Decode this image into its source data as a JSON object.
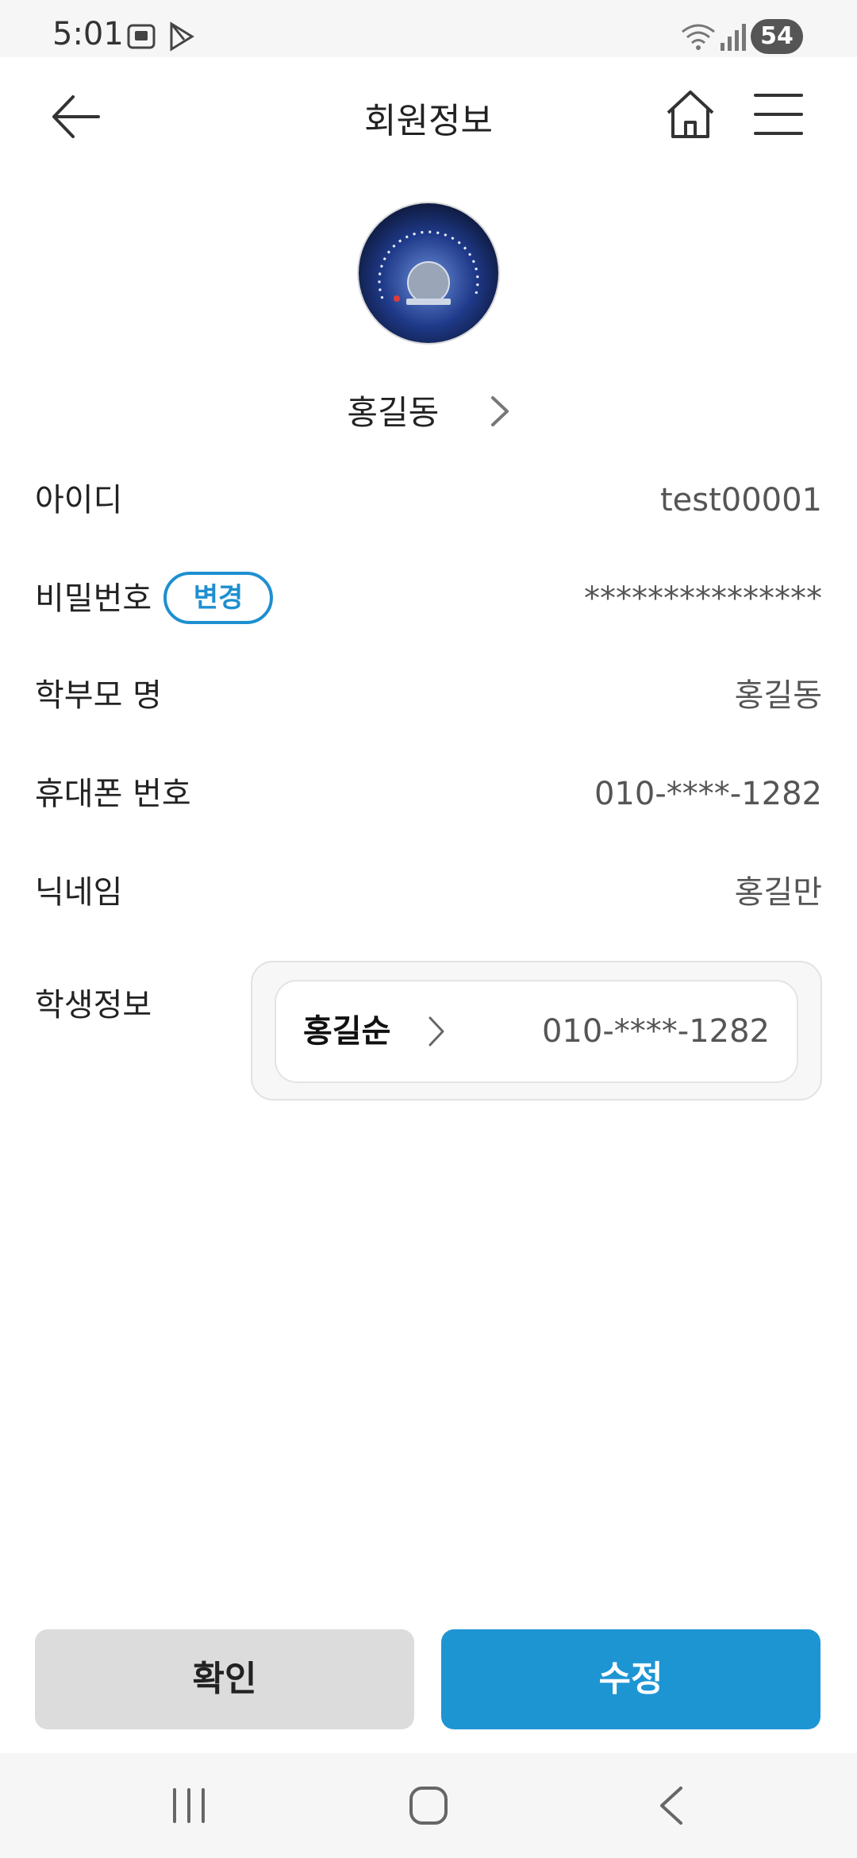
{
  "status_bar": {
    "time": "5:01",
    "battery": "54"
  },
  "header": {
    "title": "회원정보"
  },
  "profile": {
    "name": "홍길동"
  },
  "fields": {
    "id": {
      "label": "아이디",
      "value": "test00001"
    },
    "password": {
      "label": "비밀번호",
      "change_label": "변경",
      "value": "***************"
    },
    "parent_name": {
      "label": "학부모 명",
      "value": "홍길동"
    },
    "phone": {
      "label": "휴대폰 번호",
      "value": "010-****-1282"
    },
    "nickname": {
      "label": "닉네임",
      "value": "홍길만"
    },
    "student": {
      "label": "학생정보",
      "name": "홍길순",
      "phone": "010-****-1282"
    }
  },
  "buttons": {
    "confirm": "확인",
    "edit": "수정"
  },
  "colors": {
    "accent": "#1e95d3",
    "confirm_bg": "#dcdcdc"
  }
}
